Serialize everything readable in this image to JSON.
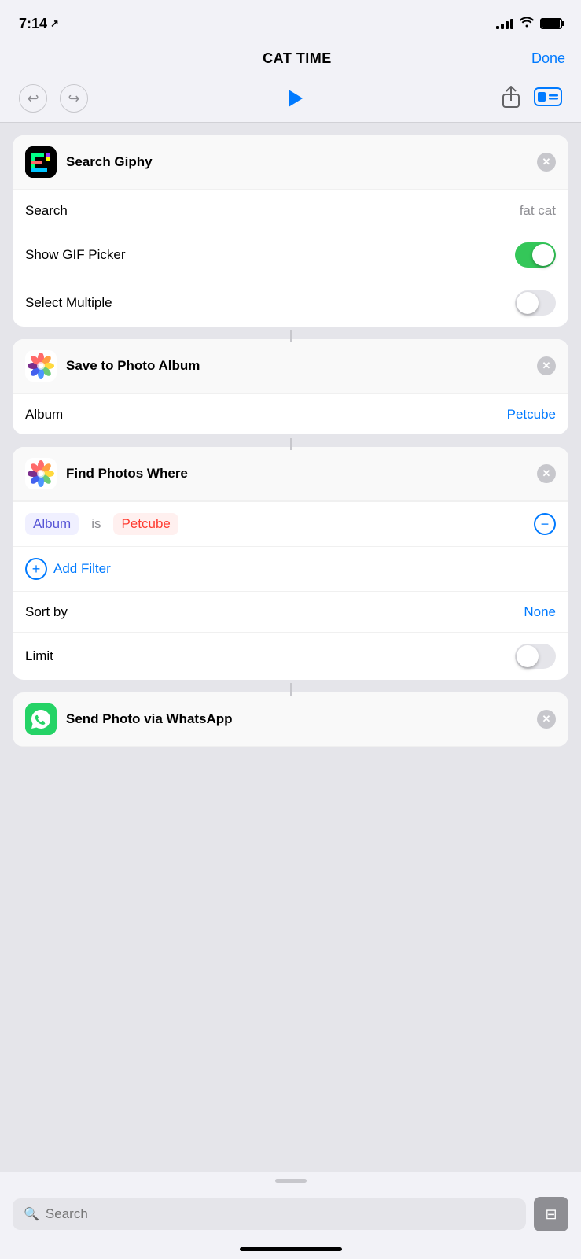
{
  "status_bar": {
    "time": "7:14",
    "location_arrow": "↗"
  },
  "nav": {
    "title": "CAT TIME",
    "done_label": "Done"
  },
  "toolbar": {
    "undo_label": "↩",
    "redo_label": "↪",
    "play_label": "Play",
    "share_label": "Share",
    "toggle_label": "Toggle View"
  },
  "cards": {
    "search_giphy": {
      "title": "Search Giphy",
      "search_label": "Search",
      "search_value": "fat cat",
      "show_gif_picker_label": "Show GIF Picker",
      "show_gif_picker_on": true,
      "select_multiple_label": "Select Multiple",
      "select_multiple_on": false
    },
    "save_to_photo_album": {
      "title": "Save to Photo Album",
      "album_label": "Album",
      "album_value": "Petcube"
    },
    "find_photos_where": {
      "title": "Find Photos Where",
      "filter_field": "Album",
      "filter_op": "is",
      "filter_value": "Petcube",
      "add_filter_label": "Add Filter",
      "sort_by_label": "Sort by",
      "sort_by_value": "None",
      "limit_label": "Limit",
      "limit_on": false
    },
    "send_photo_whatsapp": {
      "title": "Send Photo via WhatsApp"
    }
  },
  "bottom_search": {
    "placeholder": "Search"
  }
}
